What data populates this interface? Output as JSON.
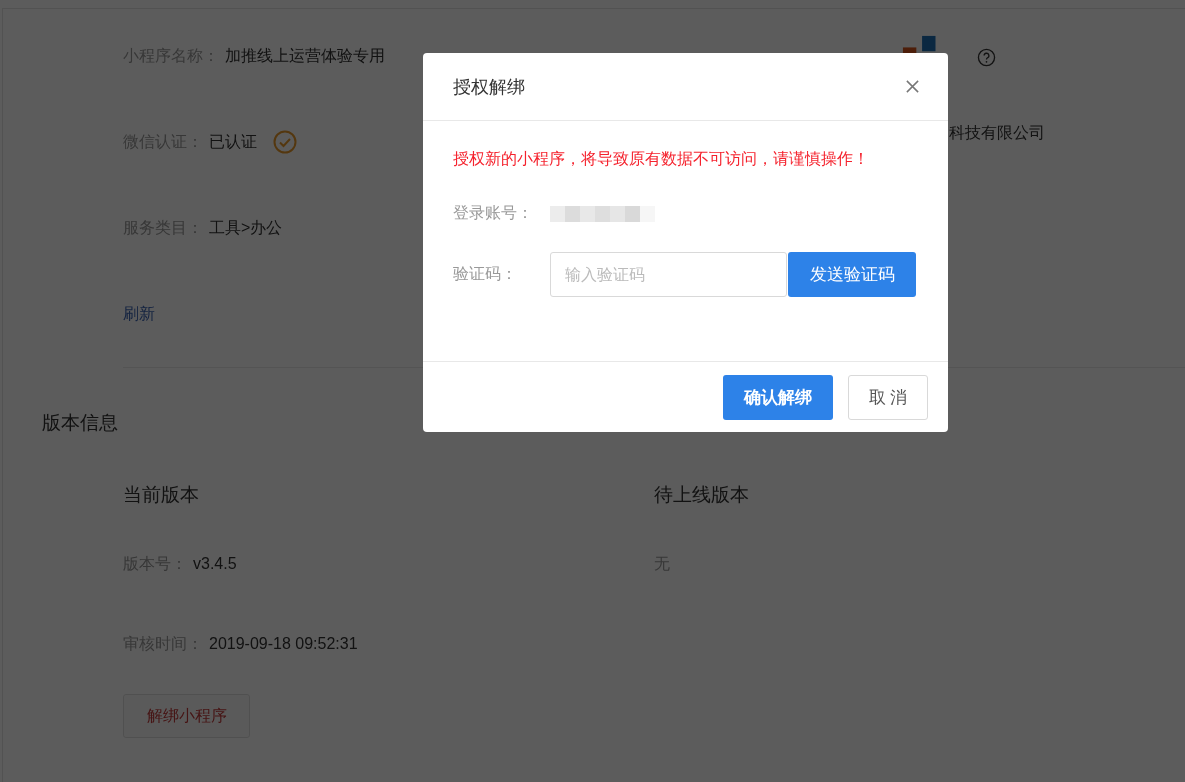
{
  "page": {
    "info_rows": [
      {
        "label": "小程序名称：",
        "value": "加推线上运营体验专用",
        "verified": false
      },
      {
        "label": "微信认证：",
        "value": "已认证",
        "verified": true
      },
      {
        "label": "服务类目：",
        "value": "工具>办公",
        "verified": false
      }
    ],
    "company": "科技有限公司",
    "refresh_link": "刷新",
    "version_section": {
      "title": "版本信息",
      "current": {
        "heading": "当前版本",
        "rows": [
          {
            "label": "版本号：",
            "value": "v3.4.5"
          },
          {
            "label": "审核时间：",
            "value": "2019-09-18 09:52:31"
          }
        ]
      },
      "pending": {
        "heading": "待上线版本",
        "value": "无"
      },
      "unbind_button": "解绑小程序"
    }
  },
  "dialog": {
    "title": "授权解绑",
    "warning": "授权新的小程序，将导致原有数据不可访问，请谨慎操作！",
    "account_label": "登录账号：",
    "code_label": "验证码：",
    "code_placeholder": "输入验证码",
    "send_button": "发送验证码",
    "buttons": [
      {
        "label": "确认解绑",
        "kind": "primary"
      },
      {
        "label": "取 消",
        "kind": "default"
      }
    ]
  }
}
